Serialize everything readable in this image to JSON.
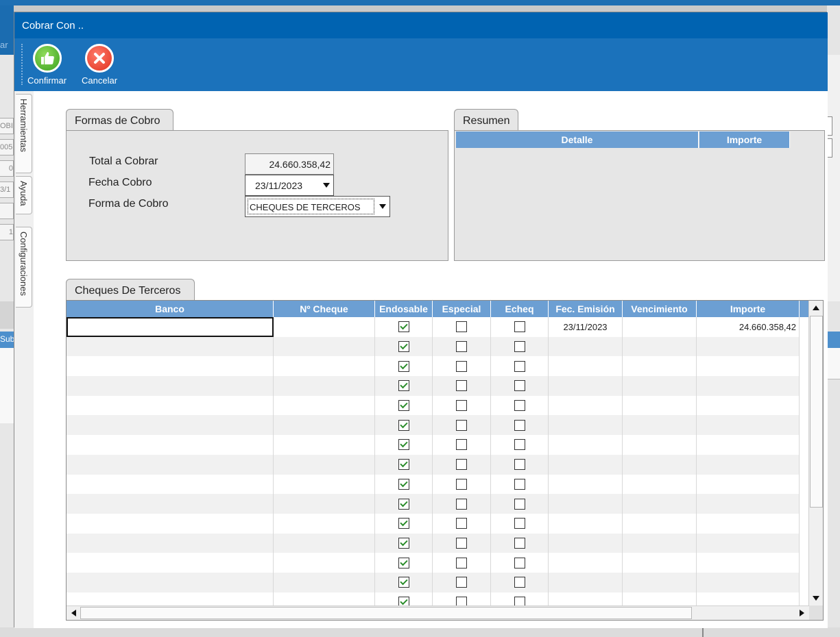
{
  "background": {
    "left_text": "ar",
    "left_fields": [
      "OBI",
      "005",
      "0",
      "3/1",
      "",
      "1"
    ],
    "sub_label": "Sub"
  },
  "dialog": {
    "title": "Cobrar Con ..",
    "toolbar": {
      "confirm_label": "Confirmar",
      "cancel_label": "Cancelar"
    },
    "side_tabs": [
      "Herramientas",
      "Ayuda",
      "Configuraciones"
    ]
  },
  "formas_de_cobro": {
    "tab_label": "Formas de Cobro",
    "total_label": "Total a Cobrar",
    "total_value": "24.660.358,42",
    "fecha_label": "Fecha Cobro",
    "fecha_value": "23/11/2023",
    "forma_label": "Forma de Cobro",
    "forma_value": "CHEQUES DE TERCEROS"
  },
  "resumen": {
    "tab_label": "Resumen",
    "columns": [
      "Detalle",
      "Importe"
    ]
  },
  "cheques": {
    "tab_label": "Cheques De Terceros",
    "columns": [
      "Banco",
      "Nº Cheque",
      "Endosable",
      "Especial",
      "Echeq",
      "Fec. Emisión",
      "Vencimiento",
      "Importe"
    ],
    "rows": [
      {
        "banco": "",
        "numero": "",
        "endosable": true,
        "especial": false,
        "echeq": false,
        "emision": "23/11/2023",
        "vencimiento": "",
        "importe": "24.660.358,42"
      },
      {
        "banco": "",
        "numero": "",
        "endosable": true,
        "especial": false,
        "echeq": false,
        "emision": "",
        "vencimiento": "",
        "importe": ""
      },
      {
        "banco": "",
        "numero": "",
        "endosable": true,
        "especial": false,
        "echeq": false,
        "emision": "",
        "vencimiento": "",
        "importe": ""
      },
      {
        "banco": "",
        "numero": "",
        "endosable": true,
        "especial": false,
        "echeq": false,
        "emision": "",
        "vencimiento": "",
        "importe": ""
      },
      {
        "banco": "",
        "numero": "",
        "endosable": true,
        "especial": false,
        "echeq": false,
        "emision": "",
        "vencimiento": "",
        "importe": ""
      },
      {
        "banco": "",
        "numero": "",
        "endosable": true,
        "especial": false,
        "echeq": false,
        "emision": "",
        "vencimiento": "",
        "importe": ""
      },
      {
        "banco": "",
        "numero": "",
        "endosable": true,
        "especial": false,
        "echeq": false,
        "emision": "",
        "vencimiento": "",
        "importe": ""
      },
      {
        "banco": "",
        "numero": "",
        "endosable": true,
        "especial": false,
        "echeq": false,
        "emision": "",
        "vencimiento": "",
        "importe": ""
      },
      {
        "banco": "",
        "numero": "",
        "endosable": true,
        "especial": false,
        "echeq": false,
        "emision": "",
        "vencimiento": "",
        "importe": ""
      },
      {
        "banco": "",
        "numero": "",
        "endosable": true,
        "especial": false,
        "echeq": false,
        "emision": "",
        "vencimiento": "",
        "importe": ""
      },
      {
        "banco": "",
        "numero": "",
        "endosable": true,
        "especial": false,
        "echeq": false,
        "emision": "",
        "vencimiento": "",
        "importe": ""
      },
      {
        "banco": "",
        "numero": "",
        "endosable": true,
        "especial": false,
        "echeq": false,
        "emision": "",
        "vencimiento": "",
        "importe": ""
      },
      {
        "banco": "",
        "numero": "",
        "endosable": true,
        "especial": false,
        "echeq": false,
        "emision": "",
        "vencimiento": "",
        "importe": ""
      },
      {
        "banco": "",
        "numero": "",
        "endosable": true,
        "especial": false,
        "echeq": false,
        "emision": "",
        "vencimiento": "",
        "importe": ""
      },
      {
        "banco": "",
        "numero": "",
        "endosable": true,
        "especial": false,
        "echeq": false,
        "emision": "",
        "vencimiento": "",
        "importe": ""
      }
    ]
  },
  "colors": {
    "title_bar": "#0063b1",
    "toolbar": "#1b72bb",
    "grid_header": "#6c9fd3",
    "check_mark": "#2a8c2a"
  }
}
